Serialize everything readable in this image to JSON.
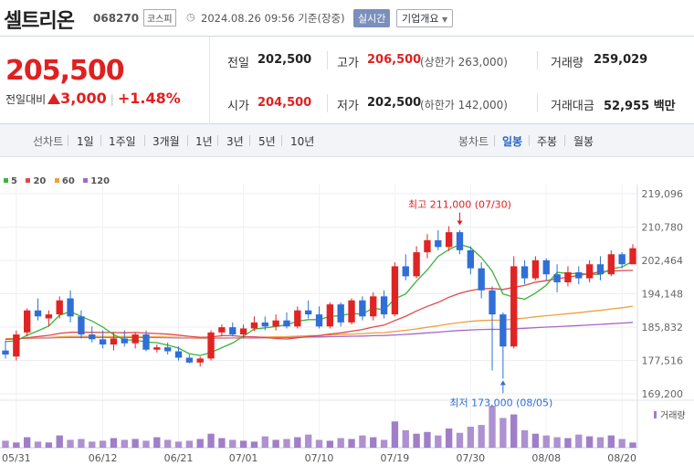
{
  "header": {
    "name": "셀트리온",
    "code": "068270",
    "market": "코스피",
    "date": "2024.08.26 09:56 기준(장중)",
    "realtime_label": "실시간",
    "corp_info_label": "기업개요"
  },
  "quote": {
    "price": "205,500",
    "change_label": "전일대비",
    "change": "3,000",
    "change_pct": "+1.48%",
    "prev_close_label": "전일",
    "prev_close": "202,500",
    "high_label": "고가",
    "high": "206,500",
    "upper_limit": "(상한가 263,000)",
    "volume_label": "거래량",
    "volume": "259,029",
    "open_label": "시가",
    "open": "204,500",
    "low_label": "저가",
    "low": "202,500",
    "lower_limit": "(하한가 142,000)",
    "amount_label": "거래대금",
    "amount": "52,955 백만"
  },
  "periods": {
    "line_label": "선차트",
    "items": [
      "1일",
      "1주일",
      "3개월",
      "1년",
      "3년",
      "5년",
      "10년"
    ],
    "candle_label": "봉차트",
    "candle_items": [
      "일봉",
      "주봉",
      "월봉"
    ],
    "candle_selected": 0
  },
  "chart_data": {
    "type": "candlestick",
    "legend": [
      {
        "name": "5",
        "color": "#3bb33b"
      },
      {
        "name": "20",
        "color": "#e04848"
      },
      {
        "name": "60",
        "color": "#f0a040"
      },
      {
        "name": "120",
        "color": "#a866c8"
      }
    ],
    "y_ticks": [
      "219,096",
      "210,780",
      "202,464",
      "194,148",
      "185,832",
      "177,516",
      "169,200"
    ],
    "ylim": [
      169200,
      219096
    ],
    "x_ticks": [
      {
        "label": "05/31",
        "i": 1
      },
      {
        "label": "06/12",
        "i": 9
      },
      {
        "label": "06/21",
        "i": 16
      },
      {
        "label": "07/01",
        "i": 22
      },
      {
        "label": "07/10",
        "i": 29
      },
      {
        "label": "07/19",
        "i": 36
      },
      {
        "label": "07/30",
        "i": 43
      },
      {
        "label": "08/08",
        "i": 50
      },
      {
        "label": "08/20",
        "i": 57
      }
    ],
    "high_annotation": {
      "label": "최고 211,000 (07/30)",
      "i": 42,
      "value": 211000
    },
    "low_annotation": {
      "label": "최저 173,000 (08/05)",
      "i": 46,
      "value": 173000
    },
    "volume_label": "거래량",
    "candles": [
      [
        180000,
        182500,
        178000,
        179000
      ],
      [
        178500,
        185000,
        177500,
        184000
      ],
      [
        184500,
        190500,
        183500,
        190000
      ],
      [
        190000,
        193000,
        187500,
        188500
      ],
      [
        188000,
        190000,
        186000,
        189000
      ],
      [
        189000,
        193500,
        188000,
        192500
      ],
      [
        193000,
        195000,
        187000,
        188500
      ],
      [
        188500,
        190000,
        183000,
        184000
      ],
      [
        184000,
        186000,
        182000,
        182800
      ],
      [
        182800,
        185000,
        180500,
        181500
      ],
      [
        181500,
        184500,
        180000,
        183000
      ],
      [
        183000,
        185000,
        181000,
        181800
      ],
      [
        181800,
        184500,
        180500,
        184000
      ],
      [
        184000,
        185000,
        179800,
        180200
      ],
      [
        180200,
        181500,
        179500,
        180800
      ],
      [
        180800,
        182000,
        179000,
        179800
      ],
      [
        179800,
        181000,
        177500,
        178200
      ],
      [
        178200,
        179000,
        176800,
        177000
      ],
      [
        177000,
        178500,
        176000,
        178000
      ],
      [
        178000,
        185000,
        177500,
        184500
      ],
      [
        184500,
        186500,
        183500,
        185800
      ],
      [
        185800,
        187000,
        183500,
        184000
      ],
      [
        184000,
        186500,
        183000,
        185500
      ],
      [
        185500,
        188500,
        184800,
        187000
      ],
      [
        187000,
        188500,
        185000,
        186000
      ],
      [
        186000,
        189000,
        185000,
        187500
      ],
      [
        187500,
        189500,
        185500,
        186000
      ],
      [
        186000,
        191000,
        185500,
        190000
      ],
      [
        190000,
        192500,
        188000,
        189000
      ],
      [
        189000,
        191000,
        185500,
        186000
      ],
      [
        186000,
        192000,
        185500,
        191500
      ],
      [
        191500,
        192000,
        186000,
        187000
      ],
      [
        187000,
        193000,
        186500,
        192500
      ],
      [
        192500,
        193500,
        187500,
        188500
      ],
      [
        188500,
        194500,
        187500,
        193500
      ],
      [
        193500,
        195000,
        188000,
        189000
      ],
      [
        189000,
        202000,
        188500,
        201000
      ],
      [
        201000,
        204000,
        197500,
        198500
      ],
      [
        198500,
        206000,
        198000,
        204500
      ],
      [
        204500,
        209000,
        203000,
        207500
      ],
      [
        207500,
        210000,
        205000,
        205800
      ],
      [
        205800,
        211000,
        204800,
        209500
      ],
      [
        209500,
        210000,
        204000,
        205000
      ],
      [
        205000,
        206000,
        199000,
        200500
      ],
      [
        200500,
        202000,
        193000,
        195000
      ],
      [
        195000,
        196000,
        175000,
        189000
      ],
      [
        189000,
        189500,
        173000,
        181000
      ],
      [
        181000,
        203500,
        180500,
        201000
      ],
      [
        201000,
        202500,
        196500,
        198000
      ],
      [
        198000,
        203500,
        197500,
        202500
      ],
      [
        202500,
        203000,
        197500,
        199000
      ],
      [
        199000,
        201500,
        194500,
        197000
      ],
      [
        197000,
        201000,
        196000,
        199500
      ],
      [
        199500,
        201000,
        196500,
        198000
      ],
      [
        198000,
        202500,
        197000,
        201500
      ],
      [
        201500,
        203500,
        197500,
        199000
      ],
      [
        199000,
        205000,
        198500,
        204000
      ],
      [
        204000,
        204500,
        200500,
        201500
      ],
      [
        201500,
        206500,
        202000,
        205500
      ]
    ],
    "volumes": [
      8,
      6,
      12,
      7,
      6,
      14,
      9,
      10,
      7,
      8,
      11,
      9,
      10,
      8,
      12,
      9,
      7,
      8,
      10,
      16,
      11,
      9,
      8,
      7,
      13,
      9,
      10,
      12,
      15,
      9,
      8,
      11,
      10,
      14,
      12,
      9,
      30,
      20,
      16,
      18,
      14,
      22,
      17,
      24,
      26,
      48,
      34,
      38,
      20,
      16,
      14,
      12,
      11,
      15,
      13,
      12,
      14,
      10,
      6
    ]
  }
}
